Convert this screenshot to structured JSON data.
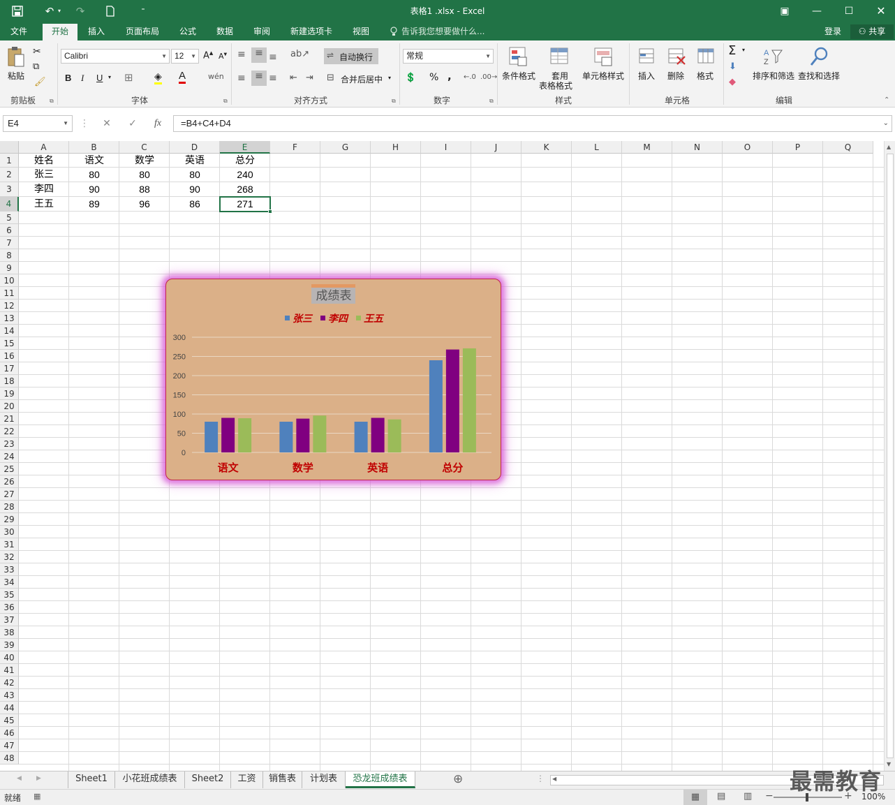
{
  "window": {
    "title": "表格1 .xlsx - Excel"
  },
  "menu": {
    "tabs": [
      "文件",
      "开始",
      "插入",
      "页面布局",
      "公式",
      "数据",
      "审阅",
      "新建选项卡",
      "视图"
    ],
    "active": "开始",
    "tell_me": "告诉我您想要做什么...",
    "login": "登录",
    "share": "共享"
  },
  "ribbon": {
    "clipboard": {
      "paste": "粘贴",
      "label": "剪贴板"
    },
    "font": {
      "name": "Calibri",
      "size": "12",
      "bold": "B",
      "italic": "I",
      "underline": "U",
      "label": "字体"
    },
    "align": {
      "wrap": "自动换行",
      "merge": "合并后居中",
      "label": "对齐方式"
    },
    "number": {
      "format": "常规",
      "percent": "%",
      "comma": ",",
      "label": "数字"
    },
    "styles": {
      "cond": "条件格式",
      "table1": "套用",
      "table2": "表格格式",
      "cell": "单元格样式",
      "label": "样式"
    },
    "cells": {
      "insert": "插入",
      "delete": "删除",
      "format": "格式",
      "label": "单元格"
    },
    "editing": {
      "sort": "排序和筛选",
      "find": "查找和选择",
      "label": "编辑"
    }
  },
  "formula_bar": {
    "name_box": "E4",
    "formula": "=B4+C4+D4",
    "fx": "fx"
  },
  "grid": {
    "columns": [
      "A",
      "B",
      "C",
      "D",
      "E",
      "F",
      "G",
      "H",
      "I",
      "J",
      "K",
      "L",
      "M",
      "N",
      "O",
      "P",
      "Q"
    ],
    "selected_column": "E",
    "selected_row": 4,
    "row_count": 48,
    "rows": [
      [
        "姓名",
        "语文",
        "数学",
        "英语",
        "总分"
      ],
      [
        "张三",
        "80",
        "80",
        "80",
        "240"
      ],
      [
        "李四",
        "90",
        "88",
        "90",
        "268"
      ],
      [
        "王五",
        "89",
        "96",
        "86",
        "271"
      ]
    ]
  },
  "chart_data": {
    "type": "bar",
    "title": "成绩表",
    "categories": [
      "语文",
      "数学",
      "英语",
      "总分"
    ],
    "series": [
      {
        "name": "张三",
        "values": [
          80,
          80,
          80,
          240
        ],
        "color": "#4f81bd"
      },
      {
        "name": "李四",
        "values": [
          90,
          88,
          90,
          268
        ],
        "color": "#800080"
      },
      {
        "name": "王五",
        "values": [
          89,
          96,
          86,
          271
        ],
        "color": "#9bbb59"
      }
    ],
    "ylim": [
      0,
      300
    ],
    "yticks": [
      "0",
      "50",
      "100",
      "150",
      "200",
      "250",
      "300"
    ],
    "legend": "top",
    "grid": true,
    "colors": {
      "background": "#dbb088",
      "border": "#c0254d",
      "label": "#c00000"
    }
  },
  "sheets": {
    "tabs": [
      "Sheet1",
      "小花班成绩表",
      "Sheet2",
      "工资",
      "销售表",
      "计划表",
      "恐龙班成绩表"
    ],
    "active": "恐龙班成绩表"
  },
  "status": {
    "ready": "就绪",
    "zoom": "100%"
  },
  "watermark": "最需教育"
}
